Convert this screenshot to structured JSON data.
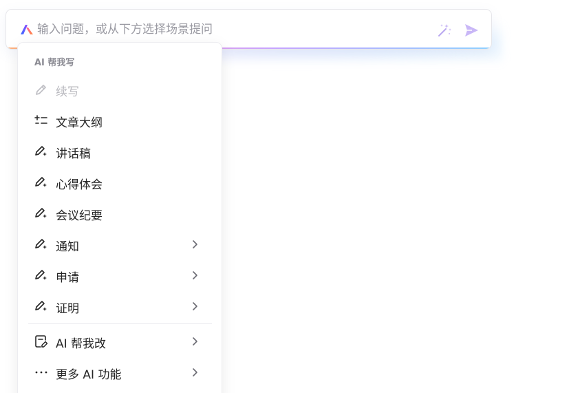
{
  "ask_bar": {
    "placeholder": "输入问题，或从下方选择场景提问",
    "value": "",
    "logo_icon": "ai-logo-icon",
    "magic_icon": "magic-wand-icon",
    "send_icon": "send-icon",
    "gradient_colors": [
      "#ffb27a",
      "#f29ad8",
      "#c7a4ff",
      "#8fd0ff"
    ]
  },
  "menu": {
    "header": "AI 帮我写",
    "items": [
      {
        "label": "续写",
        "icon": "pen-icon",
        "disabled": true,
        "submenu": false
      },
      {
        "label": "文章大纲",
        "icon": "outline-list-icon",
        "disabled": false,
        "submenu": false
      },
      {
        "label": "讲话稿",
        "icon": "pen-sparkle-icon",
        "disabled": false,
        "submenu": false
      },
      {
        "label": "心得体会",
        "icon": "pen-sparkle-icon",
        "disabled": false,
        "submenu": false
      },
      {
        "label": "会议纪要",
        "icon": "pen-sparkle-icon",
        "disabled": false,
        "submenu": false
      },
      {
        "label": "通知",
        "icon": "pen-sparkle-icon",
        "disabled": false,
        "submenu": true
      },
      {
        "label": "申请",
        "icon": "pen-sparkle-icon",
        "disabled": false,
        "submenu": true
      },
      {
        "label": "证明",
        "icon": "pen-sparkle-icon",
        "disabled": false,
        "submenu": true
      },
      {
        "label": "AI 帮我改",
        "icon": "document-edit-icon",
        "disabled": false,
        "submenu": true
      },
      {
        "label": "更多 AI 功能",
        "icon": "more-dots-icon",
        "disabled": false,
        "submenu": true
      }
    ]
  }
}
